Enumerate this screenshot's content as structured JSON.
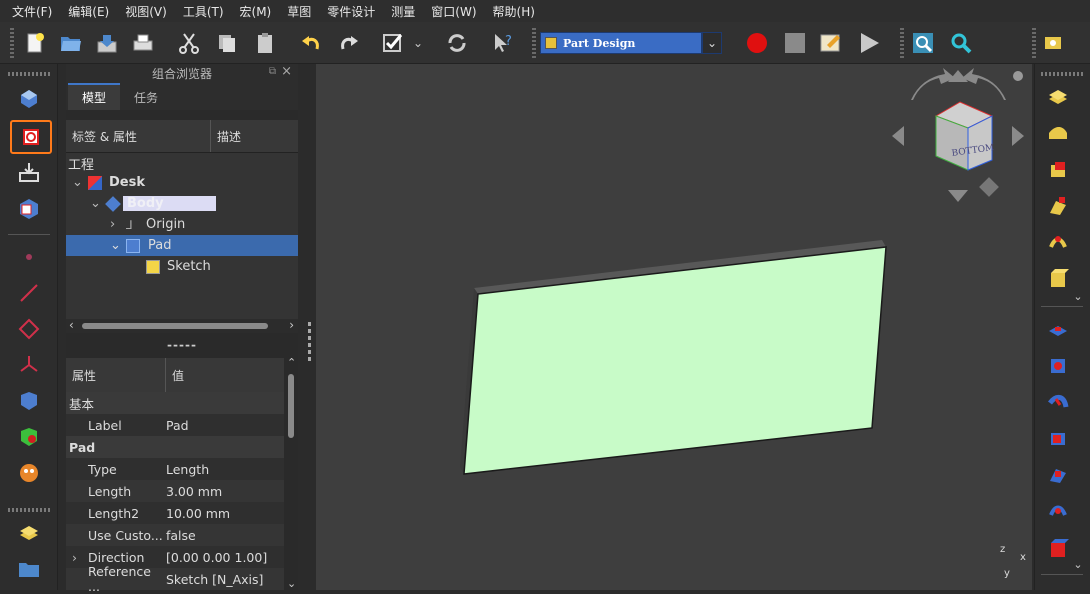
{
  "menu": [
    "文件(F)",
    "编辑(E)",
    "视图(V)",
    "工具(T)",
    "宏(M)",
    "草图",
    "零件设计",
    "测量",
    "窗口(W)",
    "帮助(H)"
  ],
  "toolbar": {
    "workbench": "Part Design",
    "icons": [
      "new-file-icon",
      "open-folder-icon",
      "save-icon",
      "print-icon",
      "cut-icon",
      "copy-icon",
      "paste-icon",
      "undo-icon",
      "redo-icon",
      "refresh-check-icon",
      "recompute-icon",
      "whats-this-icon",
      "record-macro-icon",
      "stop-macro-icon",
      "edit-macro-icon",
      "run-macro-icon",
      "zoom-fit-icon",
      "zoom-icon",
      "measure-icon"
    ]
  },
  "combo": {
    "title": "组合浏览器",
    "tabs": [
      "模型",
      "任务"
    ],
    "tree_headers": [
      "标签 & 属性",
      "描述"
    ],
    "section": "工程",
    "tree": [
      {
        "label": "Desk",
        "bold": true
      },
      {
        "label": "Body",
        "bold": true
      },
      {
        "label": "Origin"
      },
      {
        "label": "Pad",
        "selected": true
      },
      {
        "label": "Sketch"
      }
    ],
    "splitter": "-----",
    "prop_headers": [
      "属性",
      "值"
    ],
    "props": [
      {
        "group": "基本"
      },
      {
        "name": "Label",
        "value": "Pad"
      },
      {
        "group": "Pad"
      },
      {
        "name": "Type",
        "value": "Length"
      },
      {
        "name": "Length",
        "value": "3.00 mm"
      },
      {
        "name": "Length2",
        "value": "10.00 mm"
      },
      {
        "name": "Use Custo...",
        "value": "false"
      },
      {
        "name": "Direction",
        "value": "[0.00 0.00 1.00]"
      },
      {
        "name": "Reference ...",
        "value": "Sketch [N_Axis]"
      }
    ]
  },
  "navcube": {
    "face": "BOTTOM"
  },
  "axis_labels": {
    "x": "x",
    "y": "y",
    "z": "z"
  },
  "colors": {
    "accent": "#3b6aad",
    "pad_face": "#c8fbc8",
    "record": "#e01010"
  }
}
